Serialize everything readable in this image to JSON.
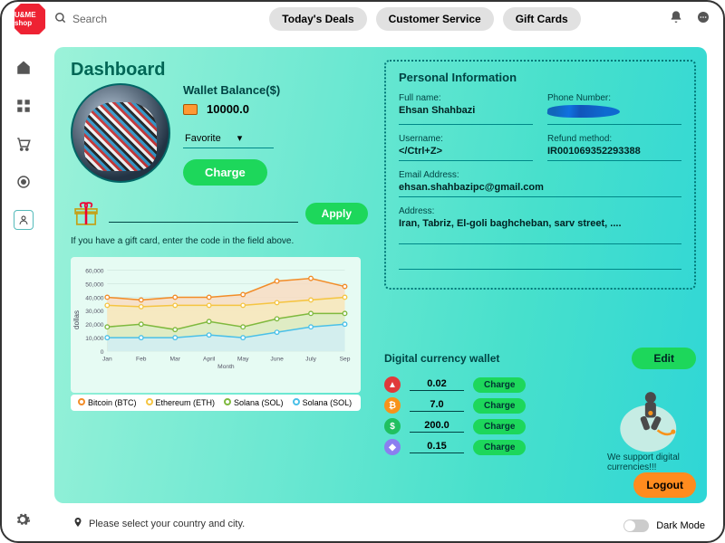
{
  "logo": "U&ME shop",
  "search_placeholder": "Search",
  "topnav": [
    "Today's Deals",
    "Customer Service",
    "Gift Cards"
  ],
  "page_title": "Dashboard",
  "wallet": {
    "label": "Wallet Balance($)",
    "value": "10000.0",
    "select": "Favorite",
    "charge": "Charge"
  },
  "gift": {
    "apply": "Apply",
    "note": "If you have a gift card, enter the code in the field above."
  },
  "personal": {
    "title": "Personal Information",
    "fullname_l": "Full name:",
    "fullname": "Ehsan Shahbazi",
    "phone_l": "Phone Number:",
    "username_l": "Username:",
    "username": "</Ctrl+Z>",
    "refund_l": "Refund method:",
    "refund": "IR001069352293388",
    "email_l": "Email Address:",
    "email": "ehsan.shahbazipc@gmail.com",
    "address_l": "Address:",
    "address": "Iran, Tabriz, El-goli baghcheban, sarv street, ...."
  },
  "dcw": {
    "title": "Digital currency wallet",
    "edit": "Edit",
    "rows": [
      {
        "sym": "▲",
        "color": "#e03a3a",
        "val": "0.02"
      },
      {
        "sym": "₿",
        "color": "#f7931a",
        "val": "7.0"
      },
      {
        "sym": "$",
        "color": "#20c060",
        "val": "200.0"
      },
      {
        "sym": "◆",
        "color": "#8a7ff0",
        "val": "0.15"
      }
    ],
    "charge": "Charge"
  },
  "support": "We support digital currencies!!!",
  "logout": "Logout",
  "footer_loc": "Please select your country and city.",
  "darkmode": "Dark Mode",
  "chart_data": {
    "type": "line",
    "xlabel": "Month",
    "ylabel": "dollas",
    "ylim": [
      0,
      60000
    ],
    "categories": [
      "Jan",
      "Feb",
      "Mar",
      "April",
      "May",
      "June",
      "July",
      "Sep"
    ],
    "series": [
      {
        "name": "Bitcoin (BTC)",
        "color": "#f28c28",
        "values": [
          40000,
          38000,
          40000,
          40000,
          42000,
          52000,
          54000,
          48000
        ]
      },
      {
        "name": "Ethereum (ETH)",
        "color": "#f5c542",
        "values": [
          34000,
          33000,
          34000,
          34000,
          34000,
          36000,
          38000,
          40000
        ]
      },
      {
        "name": "Solana (SOL)",
        "color": "#7fb93e",
        "values": [
          18000,
          20000,
          16000,
          22000,
          18000,
          24000,
          28000,
          28000
        ]
      },
      {
        "name": "Solana (SOL)",
        "color": "#4ac0e8",
        "values": [
          10000,
          10000,
          10000,
          12000,
          10000,
          14000,
          18000,
          20000
        ]
      }
    ]
  }
}
